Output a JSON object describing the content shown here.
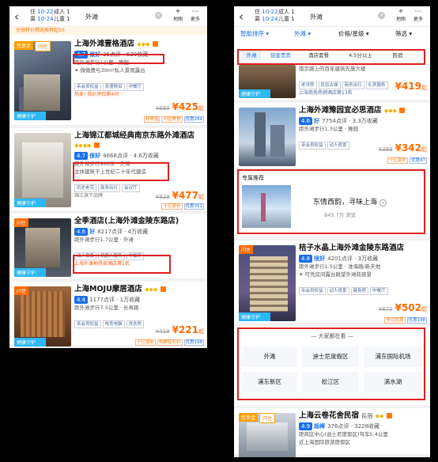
{
  "header": {
    "back_icon": "chevron-left-icon",
    "checkin_label": "住",
    "checkin_date": "10-22",
    "checkout_label": "离",
    "checkout_date": "10-24",
    "adults": "成人 1",
    "children": "儿童 1",
    "location": "外滩",
    "map_label": "地图",
    "more_label": "更多"
  },
  "left": {
    "promo": "住宿特价精选推荐起50",
    "hotels": [
      {
        "name": "上海外滩壹格酒店",
        "tags": [
          "优享会",
          "闪住"
        ],
        "score": "4.7",
        "score_word": "很好",
        "reviews": "35点评",
        "favs": "620收藏",
        "distance": "距外滩步行1公里 · 豫园",
        "line2": "微微费与30m²私人景观露台",
        "chips": [
          "亲会员权益",
          "浪漫情侣",
          "中餐厅"
        ],
        "hot": "热卖! 低价房仅剩4间",
        "guard": "健康守护",
        "price_old": "¥689",
        "price_cur": "¥425",
        "price_suffix": "起",
        "perks": [
          "粉骨摇",
          "闪住美食",
          "优惠284"
        ]
      },
      {
        "name": "上海锦江都城经典南京东路外滩酒店",
        "tags": [],
        "score": "4.7",
        "score_word": "很好",
        "reviews": "4668点评",
        "favs": "4.6万收藏",
        "distance": "距外滩步行900米 · 外滩",
        "line2": "主体建筑于上世纪二十年代建造",
        "chips": [
          "历史老宅",
          "商务出行",
          "会议厅"
        ],
        "hot": "锦江旗下品牌",
        "guard": "健康守护",
        "price_old": "¥829",
        "price_cur": "¥477",
        "price_suffix": "起",
        "perks": [
          "十亿豪补",
          "优惠352"
        ]
      },
      {
        "name": "全季酒店(上海外滩金陵东路店)",
        "tags": [
          "闪住"
        ],
        "score": "4.6",
        "score_word": "好",
        "reviews": "8217点评",
        "favs": "4万收藏",
        "distance": "距外滩步行1.7公里 · 外滩",
        "line2": "",
        "chips": [
          "动人夜景",
          "机器人服务",
          "中餐厅"
        ],
        "hot": "上海外滩地热卖酒店第1名",
        "guard": "健康守护",
        "price_old": "",
        "price_cur": "",
        "price_suffix": "",
        "perks": []
      },
      {
        "name": "上海MOJU摩居酒店",
        "tags": [
          "闪住"
        ],
        "score": "4.4",
        "score_word": "",
        "reviews": "1177点评",
        "favs": "1万收藏",
        "distance": "距外滩步行7.5公里 · 长寿路",
        "line2": "",
        "chips": [
          "亲会员权益",
          "电竞电脑",
          "洗衣房"
        ],
        "hot": "",
        "guard": "健康守护",
        "price_old": "¥419",
        "price_cur": "¥221",
        "price_suffix": "起",
        "perks": [
          "十亿豪补",
          "机票钻石价",
          "优惠198"
        ]
      }
    ]
  },
  "right": {
    "filters": [
      "智能排序",
      "外滩",
      "价格/星级",
      "筛选"
    ],
    "quick_chips": [
      "外滩",
      "铂金贵宾",
      "酒店套餐",
      "4.5分以上",
      "民宿"
    ],
    "top_snippet": {
      "line1": "南京路上的百年建筑先施大楼",
      "chips": [
        "老洋房",
        "民俗古城",
        "商务出行",
        "礼宾服务"
      ],
      "hot": "上海商务热销酒店第13名",
      "price_cur": "¥419",
      "price_suffix": "起",
      "perks": [
        "健康守护"
      ]
    },
    "hotel1": {
      "name": "上海外滩豫园宜必思酒店",
      "score": "4.6",
      "score_word": "好",
      "reviews": "7754点评",
      "favs": "3.3万收藏",
      "distance": "距外滩步行1.3公里 · 豫园",
      "chips": [
        "亲会员权益",
        "动人夜景"
      ],
      "price_old": "¥389",
      "price_cur": "¥342",
      "price_suffix": "起",
      "perks": [
        "十亿豪补",
        "优惠47"
      ]
    },
    "featured": {
      "title": "专属推荐",
      "text": "东情西韵，寻味上海",
      "views": "845.7万 浏览"
    },
    "hotel2": {
      "name": "桔子水晶上海外滩金陵东路酒店",
      "tags": [
        "闪住"
      ],
      "score": "4.8",
      "score_word": "很好",
      "reviews": "4201点评",
      "favs": "3万收藏",
      "distance": "距外滩步行1.5公里 · 淮海路/新天地",
      "line2": "可凭房间露台眺望外滩陆夜景",
      "chips": [
        "亲会员权益",
        "动人夜景",
        "健身房",
        "中餐厅"
      ],
      "guard": "健康守护",
      "price_old": "¥670",
      "price_cur": "¥502",
      "price_suffix": "起",
      "perks": [
        "早鸟优惠",
        "优惠188"
      ]
    },
    "also_viewing": {
      "title": "大家都在看",
      "places": [
        "外滩",
        "迪士尼度假区",
        "浦东国际机场",
        "浦东新区",
        "松江区",
        "滴水湖"
      ]
    },
    "hotel3": {
      "name": "上海云卷花舍民宿",
      "type": "民宿",
      "tags": [
        "优享会",
        "闪住"
      ],
      "score": "4.9",
      "score_word": "超棒",
      "reviews": "376点评",
      "favs": "3228收藏",
      "distance": "距商区中心(迪士尼度假区)驾车5.4公里",
      "line2": "近上海国际旅游度假区"
    }
  }
}
